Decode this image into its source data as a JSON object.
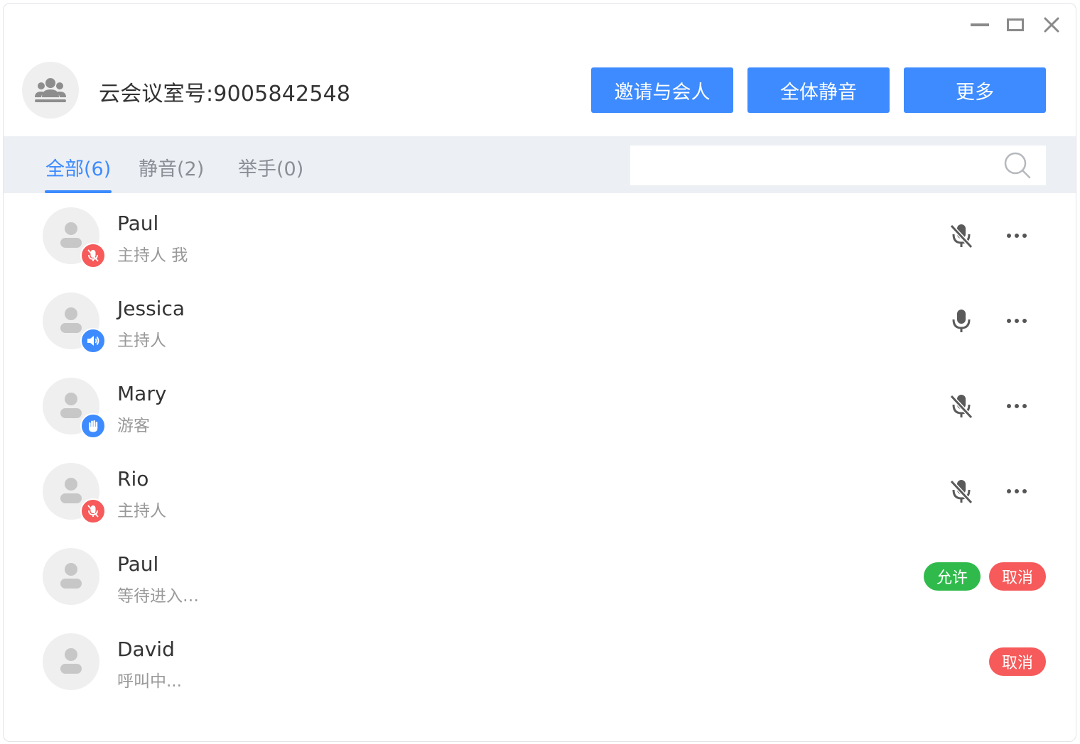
{
  "window": {
    "controls": {
      "minimize_icon": "minimize-icon",
      "maximize_icon": "maximize-icon",
      "close_icon": "close-icon"
    }
  },
  "header": {
    "room_title": "云会议室号:9005842548",
    "buttons": {
      "invite": "邀请与会人",
      "mute_all": "全体静音",
      "more": "更多"
    }
  },
  "tabs": [
    {
      "label": "全部(6)",
      "active": true
    },
    {
      "label": "静音(2)",
      "active": false
    },
    {
      "label": "举手(0)",
      "active": false
    }
  ],
  "search": {
    "placeholder": "",
    "icon": "search-icon"
  },
  "participants": [
    {
      "name": "Paul",
      "role": "主持人 我",
      "badge": "muted",
      "mic": "muted"
    },
    {
      "name": "Jessica",
      "role": "主持人",
      "badge": "speaking",
      "mic": "on"
    },
    {
      "name": "Mary",
      "role": "游客",
      "badge": "hand-raised",
      "mic": "muted"
    },
    {
      "name": "Rio",
      "role": "主持人",
      "badge": "muted",
      "mic": "muted"
    },
    {
      "name": "Paul",
      "role": "等待进入…",
      "badge": "none",
      "actions": {
        "allow": "允许",
        "cancel": "取消"
      }
    },
    {
      "name": "David",
      "role": "呼叫中...",
      "badge": "none",
      "actions": {
        "cancel": "取消"
      }
    }
  ],
  "colors": {
    "accent": "#3d8bff",
    "danger": "#f65a5a",
    "success": "#2fba4b",
    "tabbar_bg": "#eceff3"
  }
}
